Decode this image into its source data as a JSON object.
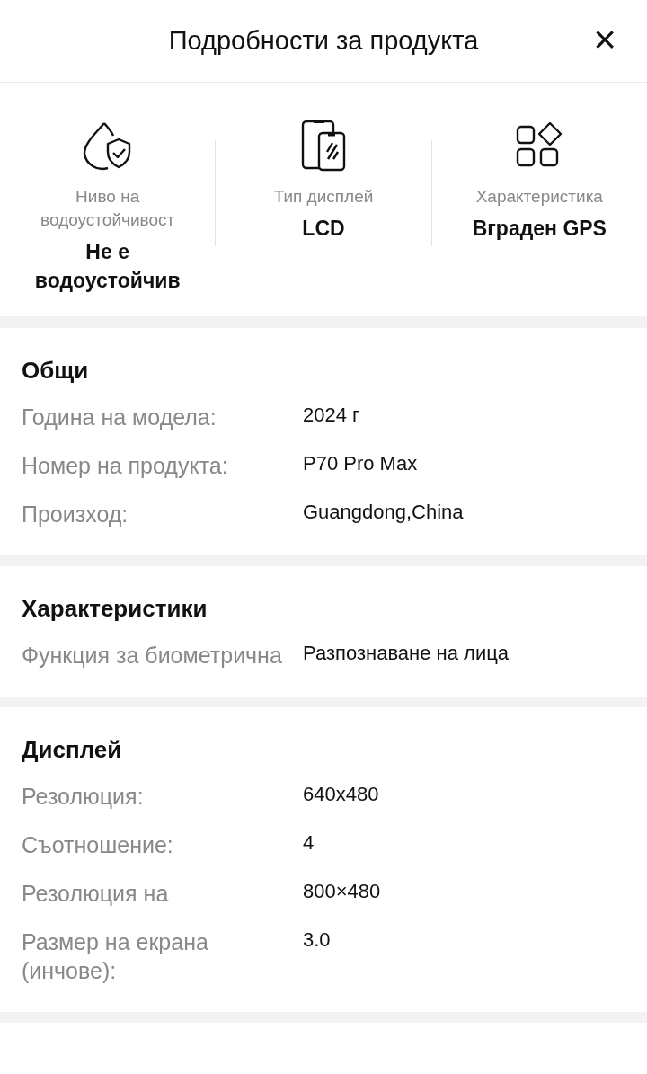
{
  "header": {
    "title": "Подробности за продукта",
    "close": "×"
  },
  "highlights": [
    {
      "kind": "water",
      "label": "Ниво на водоустойчивост",
      "value": "Не е водоустойчив"
    },
    {
      "kind": "display",
      "label": "Тип дисплей",
      "value": "LCD"
    },
    {
      "kind": "feature",
      "label": "Характеристика",
      "value": "Вграден GPS"
    }
  ],
  "sections": [
    {
      "title": "Общи",
      "rows": [
        {
          "label": "Година на модела:",
          "value": "2024 г"
        },
        {
          "label": "Номер на продукта:",
          "value": "P70 Pro Max"
        },
        {
          "label": "Произход:",
          "value": "Guangdong,China"
        }
      ]
    },
    {
      "title": "Характеристики",
      "rows": [
        {
          "label": "Функция за биометрична",
          "value": "Разпознаване на лица"
        }
      ]
    },
    {
      "title": "Дисплей",
      "rows": [
        {
          "label": "Резолюция:",
          "value": "640x480"
        },
        {
          "label": "Съотношение:",
          "value": "4"
        },
        {
          "label": "Резолюция на",
          "value": "800×480"
        },
        {
          "label": "Размер на екрана (инчове):",
          "value": "3.0"
        }
      ]
    }
  ]
}
